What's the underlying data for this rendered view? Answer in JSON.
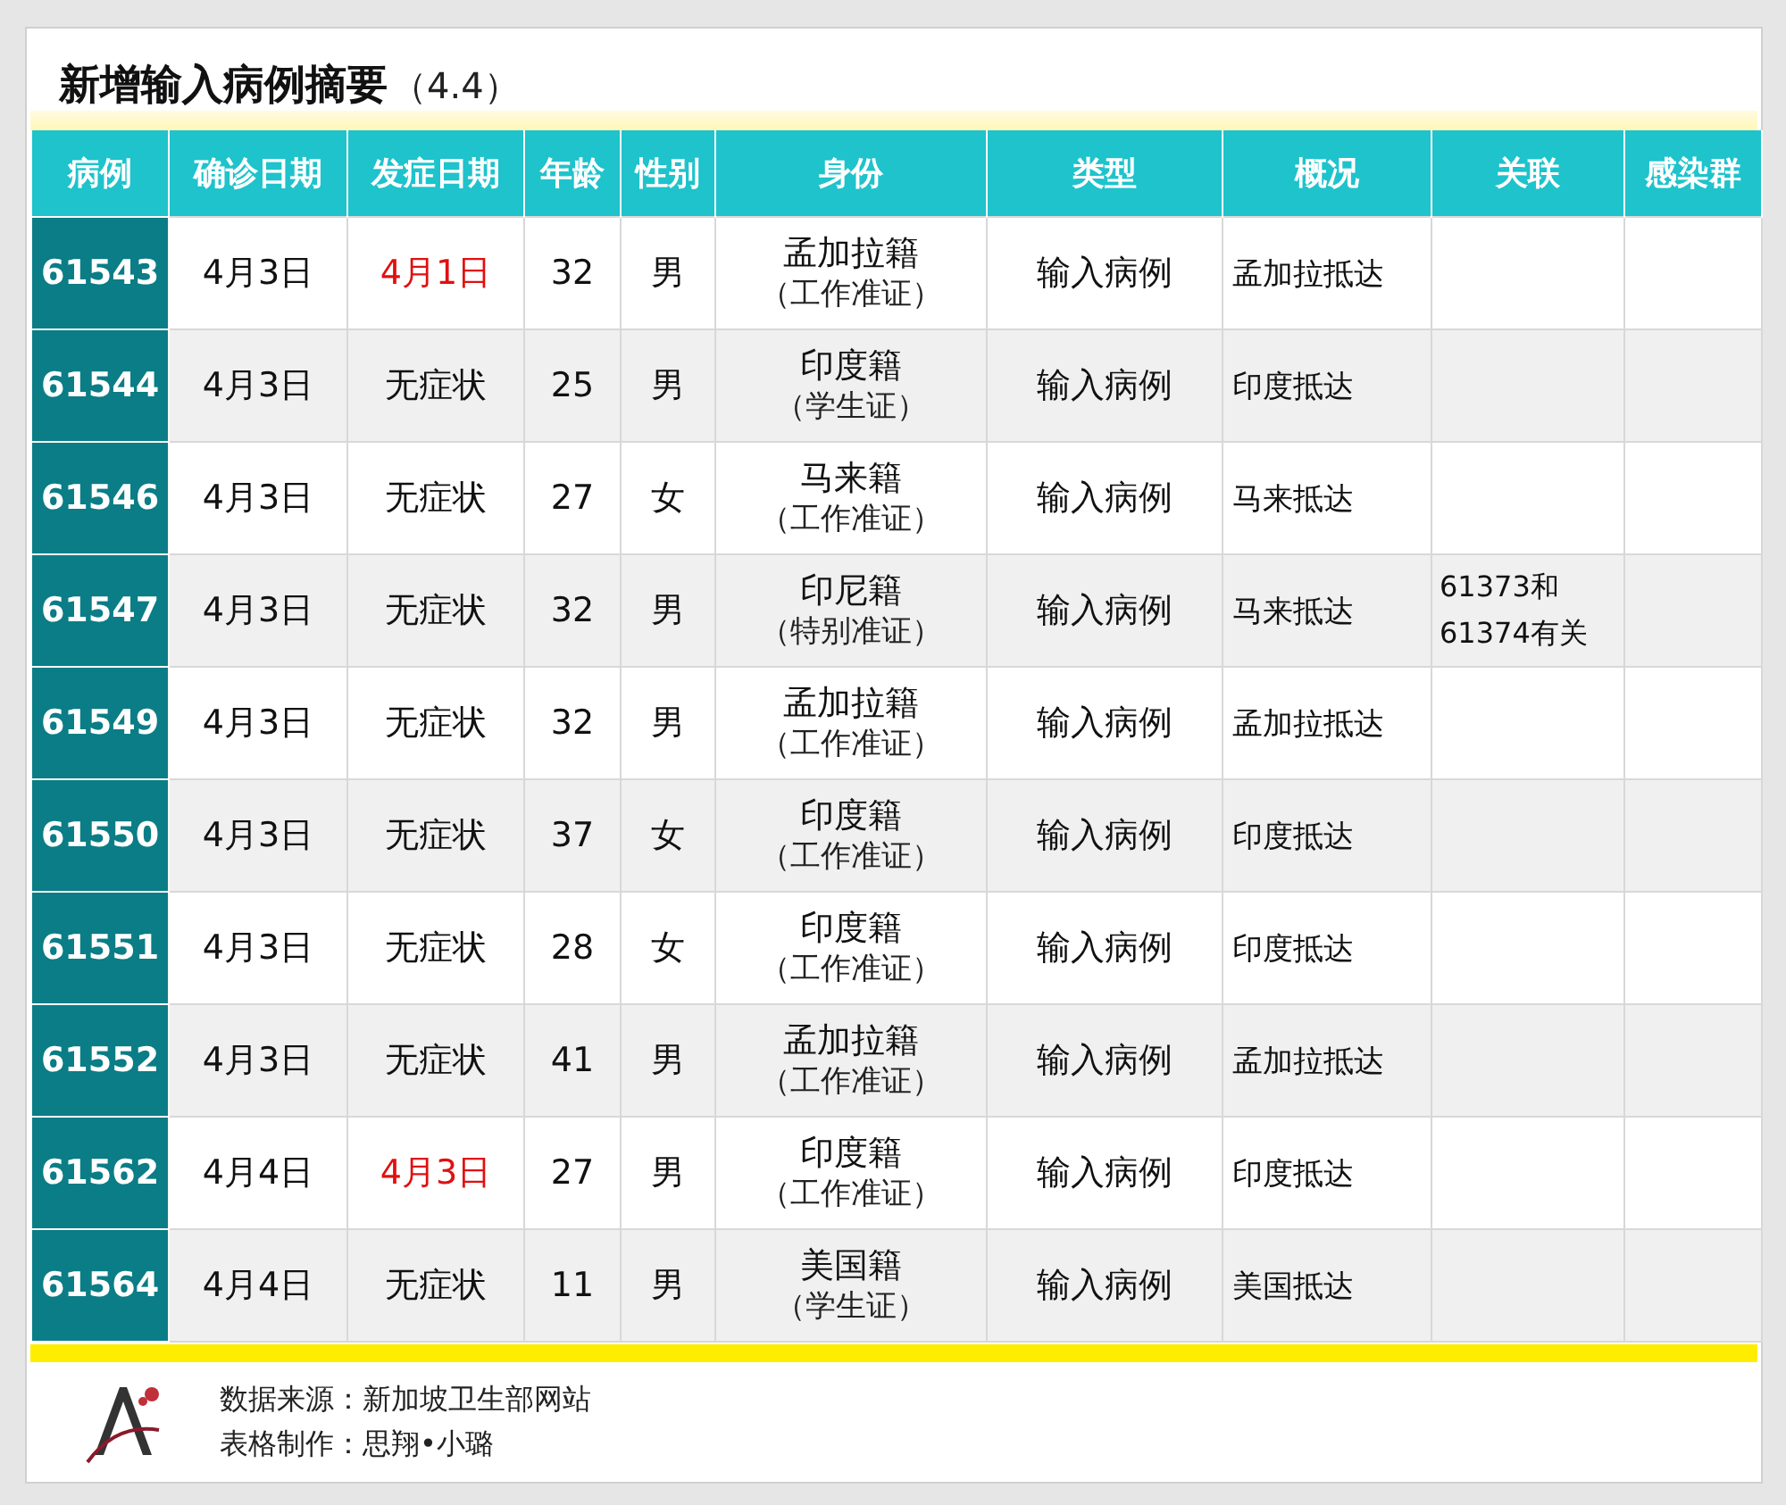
{
  "title": "新增输入病例摘要",
  "title_date": "（4.4）",
  "columns": [
    "病例",
    "确诊日期",
    "发症日期",
    "年龄",
    "性别",
    "身份",
    "类型",
    "概况",
    "关联",
    "感染群"
  ],
  "rows": [
    {
      "case": "61543",
      "confirmed": "4月3日",
      "onset": {
        "text": "4月1日",
        "highlighted": true
      },
      "age": "32",
      "sex": "男",
      "nationality": "孟加拉籍",
      "permit": "（工作准证）",
      "type": "输入病例",
      "summary": "孟加拉抵达"
    },
    {
      "case": "61544",
      "confirmed": "4月3日",
      "onset": {
        "text": "无症状",
        "highlighted": false
      },
      "age": "25",
      "sex": "男",
      "nationality": "印度籍",
      "permit": "（学生证）",
      "type": "输入病例",
      "summary": "印度抵达"
    },
    {
      "case": "61546",
      "confirmed": "4月3日",
      "onset": {
        "text": "无症状",
        "highlighted": false
      },
      "age": "27",
      "sex": "女",
      "nationality": "马来籍",
      "permit": "（工作准证）",
      "type": "输入病例",
      "summary": "马来抵达"
    },
    {
      "case": "61547",
      "confirmed": "4月3日",
      "onset": {
        "text": "无症状",
        "highlighted": false
      },
      "age": "32",
      "sex": "男",
      "nationality": "印尼籍",
      "permit": "（特别准证）",
      "type": "输入病例",
      "summary": "马来抵达",
      "linked": [
        "61373和",
        "61374有关"
      ]
    },
    {
      "case": "61549",
      "confirmed": "4月3日",
      "onset": {
        "text": "无症状",
        "highlighted": false
      },
      "age": "32",
      "sex": "男",
      "nationality": "孟加拉籍",
      "permit": "（工作准证）",
      "type": "输入病例",
      "summary": "孟加拉抵达"
    },
    {
      "case": "61550",
      "confirmed": "4月3日",
      "onset": {
        "text": "无症状",
        "highlighted": false
      },
      "age": "37",
      "sex": "女",
      "nationality": "印度籍",
      "permit": "（工作准证）",
      "type": "输入病例",
      "summary": "印度抵达"
    },
    {
      "case": "61551",
      "confirmed": "4月3日",
      "onset": {
        "text": "无症状",
        "highlighted": false
      },
      "age": "28",
      "sex": "女",
      "nationality": "印度籍",
      "permit": "（工作准证）",
      "type": "输入病例",
      "summary": "印度抵达"
    },
    {
      "case": "61552",
      "confirmed": "4月3日",
      "onset": {
        "text": "无症状",
        "highlighted": false
      },
      "age": "41",
      "sex": "男",
      "nationality": "孟加拉籍",
      "permit": "（工作准证）",
      "type": "输入病例",
      "summary": "孟加拉抵达"
    },
    {
      "case": "61562",
      "confirmed": "4月4日",
      "onset": {
        "text": "4月3日",
        "highlighted": true
      },
      "age": "27",
      "sex": "男",
      "nationality": "印度籍",
      "permit": "（工作准证）",
      "type": "输入病例",
      "summary": "印度抵达"
    },
    {
      "case": "61564",
      "confirmed": "4月4日",
      "onset": {
        "text": "无症状",
        "highlighted": false
      },
      "age": "11",
      "sex": "男",
      "nationality": "美国籍",
      "permit": "（学生证）",
      "type": "输入病例",
      "summary": "美国抵达"
    }
  ],
  "footer": [
    "数据来源：新加坡卫生部网站",
    "表格制作：思翔•小璐"
  ]
}
